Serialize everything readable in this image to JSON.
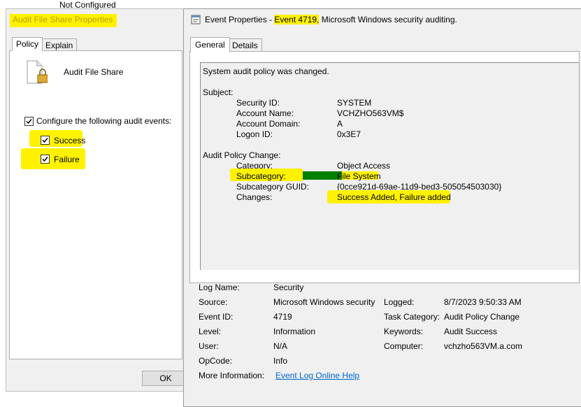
{
  "left_dialog": {
    "top_label": "Not Configured",
    "title": "Audit File Share Properties",
    "tabs": [
      {
        "label": "Policy"
      },
      {
        "label": "Explain"
      }
    ],
    "policy_name": "Audit File Share",
    "configure_label": "Configure the following audit events:",
    "success_label": "Success",
    "failure_label": "Failure",
    "ok_label": "OK"
  },
  "event_window": {
    "title_prefix": "Event Properties - ",
    "title_event": "Event 4719,",
    "title_suffix": " Microsoft Windows security auditing.",
    "tabs": [
      {
        "label": "General"
      },
      {
        "label": "Details"
      }
    ],
    "description": {
      "headline": "System audit policy was changed.",
      "subject_header": "Subject:",
      "subject_fields": [
        {
          "label": "Security ID:",
          "value": "SYSTEM"
        },
        {
          "label": "Account Name:",
          "value": "VCHZHO563VM$"
        },
        {
          "label": "Account Domain:",
          "value": "A"
        },
        {
          "label": "Logon ID:",
          "value": "0x3E7"
        }
      ],
      "policy_header": "Audit Policy Change:",
      "policy_fields": [
        {
          "label": "Category:",
          "value": "Object Access"
        },
        {
          "label": "Subcategory:",
          "value": "File System"
        },
        {
          "label": "Subcategory GUID:",
          "value": "{0cce921d-69ae-11d9-bed3-505054503030}"
        },
        {
          "label": "Changes:",
          "value": "Success Added, Failure added"
        }
      ]
    },
    "fields": {
      "log_name": {
        "label": "Log Name:",
        "value": "Security"
      },
      "source": {
        "label": "Source:",
        "value": "Microsoft Windows security"
      },
      "logged": {
        "label": "Logged:",
        "value": "8/7/2023 9:50:33 AM"
      },
      "event_id": {
        "label": "Event ID:",
        "value": "4719"
      },
      "task_category": {
        "label": "Task Category:",
        "value": "Audit Policy Change"
      },
      "level": {
        "label": "Level:",
        "value": "Information"
      },
      "keywords": {
        "label": "Keywords:",
        "value": "Audit Success"
      },
      "user": {
        "label": "User:",
        "value": "N/A"
      },
      "computer": {
        "label": "Computer:",
        "value": "vchzho563VM.a.com"
      },
      "opcode": {
        "label": "OpCode:",
        "value": "Info"
      },
      "more_info": {
        "label": "More Information:",
        "value": "Event Log Online Help"
      }
    }
  },
  "colors": {
    "highlight": "#fff200",
    "subcategory_highlight": "#008000",
    "link": "#0066cc"
  }
}
